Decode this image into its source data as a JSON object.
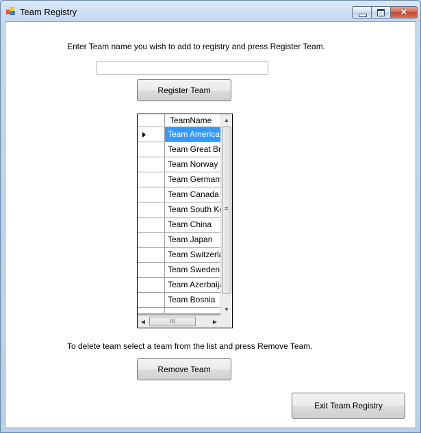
{
  "window": {
    "title": "Team Registry",
    "close_glyph": "✕"
  },
  "instructions": {
    "add": "Enter Team name you wish to add to registry and press Register Team.",
    "delete": "To delete team select a team from the list and press Remove Team."
  },
  "team_name_input": {
    "value": "",
    "placeholder": ""
  },
  "buttons": {
    "register": "Register Team",
    "remove": "Remove Team",
    "exit": "Exit Team Registry"
  },
  "grid": {
    "column_header": "TeamName",
    "rows": [
      "Team America",
      "Team Great Britain",
      "Team Norway",
      "Team Germany",
      "Team Canada",
      "Team South Korea",
      "Team China",
      "Team Japan",
      "Team Switzerland",
      "Team Sweden",
      "Team Azerbaijan",
      "Team Bosnia"
    ],
    "selected_index": 0,
    "scroll_up_glyph": "▲",
    "scroll_down_glyph": "▼",
    "scroll_left_glyph": "◀",
    "scroll_right_glyph": "▶",
    "scroll_grip_h": "III",
    "scroll_grip_v": "≡"
  },
  "colors": {
    "selection": "#3399ff",
    "title_bar": "#c4d8ef",
    "close_button": "#c2452b"
  }
}
